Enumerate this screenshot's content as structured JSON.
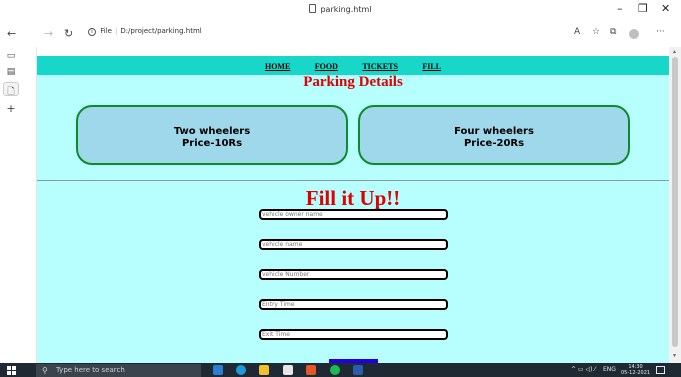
{
  "browser": {
    "tab_title": "parking.html",
    "url_scheme": "File",
    "url_path": "D:/project/parking.html",
    "window_controls": {
      "minimize": "–",
      "maximize": "❐",
      "close": "✕"
    },
    "nav_icons": {
      "back": "←",
      "forward": "→",
      "refresh": "↻"
    },
    "toolbar_icons": {
      "read_aloud": "A",
      "favorites": "☆",
      "collections": "⧉",
      "more": "···"
    }
  },
  "sidebar_icons": {
    "tabs": "▭",
    "history": "▤",
    "page": "🗋",
    "add": "+"
  },
  "page": {
    "nav": [
      "HOME",
      "FOOD",
      "TICKETS",
      "FILL"
    ],
    "heading": "Parking Details",
    "cards": [
      {
        "title": "Two wheelers",
        "price": "Price-10Rs"
      },
      {
        "title": "Four wheelers",
        "price": "Price-20Rs"
      }
    ],
    "form_heading": "Fill it Up!!",
    "fields": [
      {
        "placeholder": "vehicle owner name"
      },
      {
        "placeholder": "vehicle  name"
      },
      {
        "placeholder": "vehicle Number"
      },
      {
        "placeholder": "Entry Time"
      },
      {
        "placeholder": "Exit Time"
      }
    ],
    "colors": {
      "page_bg": "#b7ffff",
      "nav_bg": "#18d6c8",
      "heading": "#e10000",
      "card_bg": "#9fd8ea",
      "card_border": "#0d8a2a",
      "submit": "#2200dd"
    }
  },
  "taskbar": {
    "search_placeholder": "Type here to search",
    "language": "ENG",
    "time": "14:30",
    "date": "05-12-2021"
  }
}
